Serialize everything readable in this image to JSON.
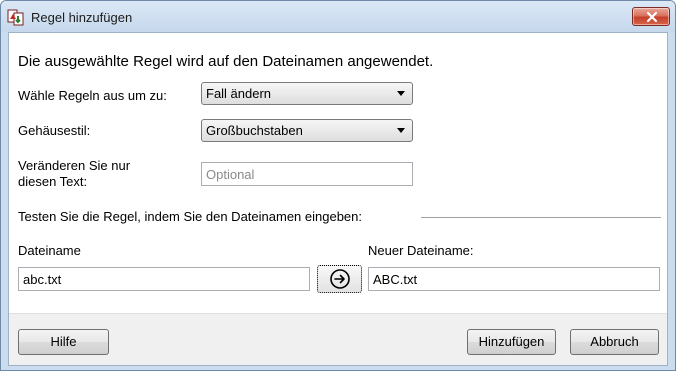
{
  "window": {
    "title": "Regel hinzufügen",
    "close_icon": "close-x-icon",
    "app_icon": "rename-rule-icon"
  },
  "form": {
    "heading": "Die ausgewählte Regel wird auf den Dateinamen angewendet.",
    "rule_label": "Wähle Regeln aus um zu:",
    "rule_value": "Fall ändern",
    "case_label": "Gehäusestil:",
    "case_value": "Großbuchstaben",
    "text_label_line1": "Veränderen Sie nur",
    "text_label_line2": "diesen Text:",
    "text_value": "",
    "text_placeholder": "Optional"
  },
  "test": {
    "section_label": "Testen Sie die Regel, indem Sie den Dateinamen eingeben:",
    "filename_label": "Dateiname",
    "filename_value": "abc.txt",
    "convert_icon": "arrow-right-circle-icon",
    "new_filename_label": "Neuer Dateiname:",
    "new_filename_value": "ABC.txt"
  },
  "footer": {
    "help_label": "Hilfe",
    "add_label": "Hinzufügen",
    "cancel_label": "Abbruch"
  },
  "colors": {
    "frame": "#cbdcef",
    "close_button": "#c6402a"
  }
}
